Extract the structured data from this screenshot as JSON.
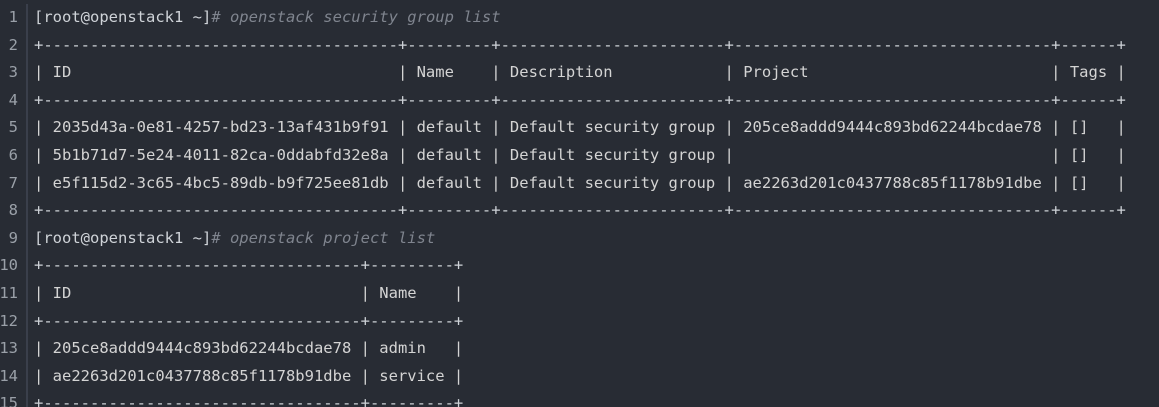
{
  "gutter_numbers": [
    "1",
    "2",
    "3",
    "4",
    "5",
    "6",
    "7",
    "8",
    "9",
    "10",
    "11",
    "12",
    "13",
    "14",
    "15"
  ],
  "commands": [
    {
      "prompt": "[root@openstack1 ~]",
      "command": "# openstack security group list"
    },
    {
      "prompt": "[root@openstack1 ~]",
      "command": "# openstack project list"
    }
  ],
  "security_group_table": {
    "border": "+--------------------------------------+---------+------------------------+----------------------------------+------+",
    "header": "| ID                                   | Name    | Description            | Project                          | Tags |",
    "rows": [
      "| 2035d43a-0e81-4257-bd23-13af431b9f91 | default | Default security group | 205ce8addd9444c893bd62244bcdae78 | []   |",
      "| 5b1b71d7-5e24-4011-82ca-0ddabfd32e8a | default | Default security group |                                  | []   |",
      "| e5f115d2-3c65-4bc5-89db-b9f725ee81db | default | Default security group | ae2263d201c0437788c85f1178b91dbe | []   |"
    ]
  },
  "project_table": {
    "border": "+----------------------------------+---------+",
    "header": "| ID                               | Name    |",
    "rows": [
      "| 205ce8addd9444c893bd62244bcdae78 | admin   |",
      "| ae2263d201c0437788c85f1178b91dbe | service |"
    ],
    "border_bottom": "+----------------------------------+---------+"
  },
  "colors": {
    "background": "#282c34",
    "text": "#d4d4d4",
    "comment": "#7f848e",
    "gutter": "#9aa0a8"
  }
}
